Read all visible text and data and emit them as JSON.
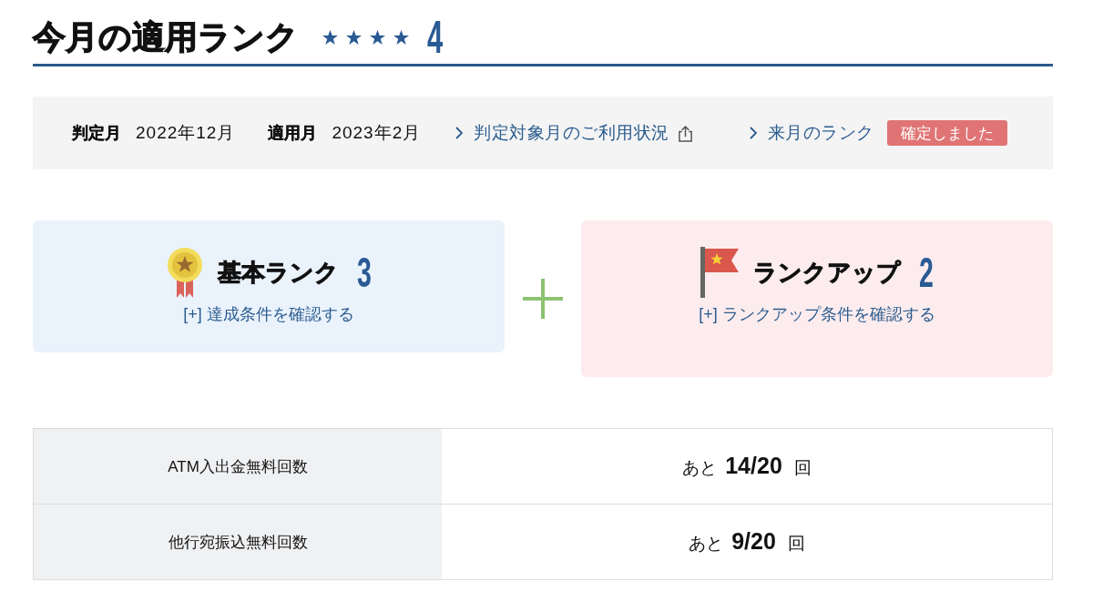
{
  "header": {
    "title": "今月の適用ランク",
    "stars": 4,
    "rank": "4"
  },
  "summary": {
    "fields": [
      {
        "label": "判定月",
        "value": "2022年12月"
      },
      {
        "label": "適用月",
        "value": "2023年2月"
      }
    ],
    "links": [
      {
        "label": "判定対象月のご利用状況",
        "external": true
      },
      {
        "label": "来月のランク",
        "external": false
      }
    ],
    "badge": "確定しました"
  },
  "ranks": [
    {
      "kind": "basic",
      "title": "基本ランク",
      "rank": "3",
      "link": "[+] 達成条件を確認する"
    },
    {
      "kind": "rankup",
      "title": "ランクアップ",
      "rank": "2",
      "link": "[+] ランクアップ条件を確認する"
    }
  ],
  "table": {
    "rows": [
      {
        "label": "ATM入出金無料回数",
        "value": "あと **14/20** 回"
      },
      {
        "label": "他行宛振込無料回数",
        "value": "あと **9/20** 回"
      }
    ]
  }
}
